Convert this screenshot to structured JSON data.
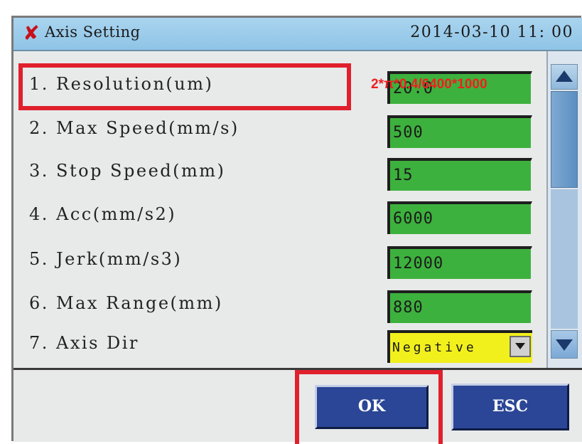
{
  "window": {
    "title": "Axis Setting",
    "datetime": "2014-03-10 11: 00",
    "icon": "close-x-icon",
    "icon_glyph": "✘"
  },
  "fields": [
    {
      "label": "1. Resolution(um)",
      "value": "20.0"
    },
    {
      "label": "2. Max Speed(mm/s)",
      "value": "500"
    },
    {
      "label": "3. Stop Speed(mm)",
      "value": "15"
    },
    {
      "label": "4. Acc(mm/s2)",
      "value": "6000"
    },
    {
      "label": "5. Jerk(mm/s3)",
      "value": "12000"
    },
    {
      "label": "6. Max Range(mm)",
      "value": "880"
    },
    {
      "label": "7. Axis Dir",
      "value": "Negative"
    }
  ],
  "annotation": {
    "text": "2*π*0.4/6400*1000",
    "color": "#ee2020"
  },
  "buttons": {
    "ok": "OK",
    "esc": "ESC"
  },
  "colors": {
    "field_bg": "#3db13d",
    "dropdown_bg": "#f2f01c",
    "button_bg": "#2b4696",
    "title_bg": "#a9d4ef",
    "highlight": "#e0202c"
  }
}
